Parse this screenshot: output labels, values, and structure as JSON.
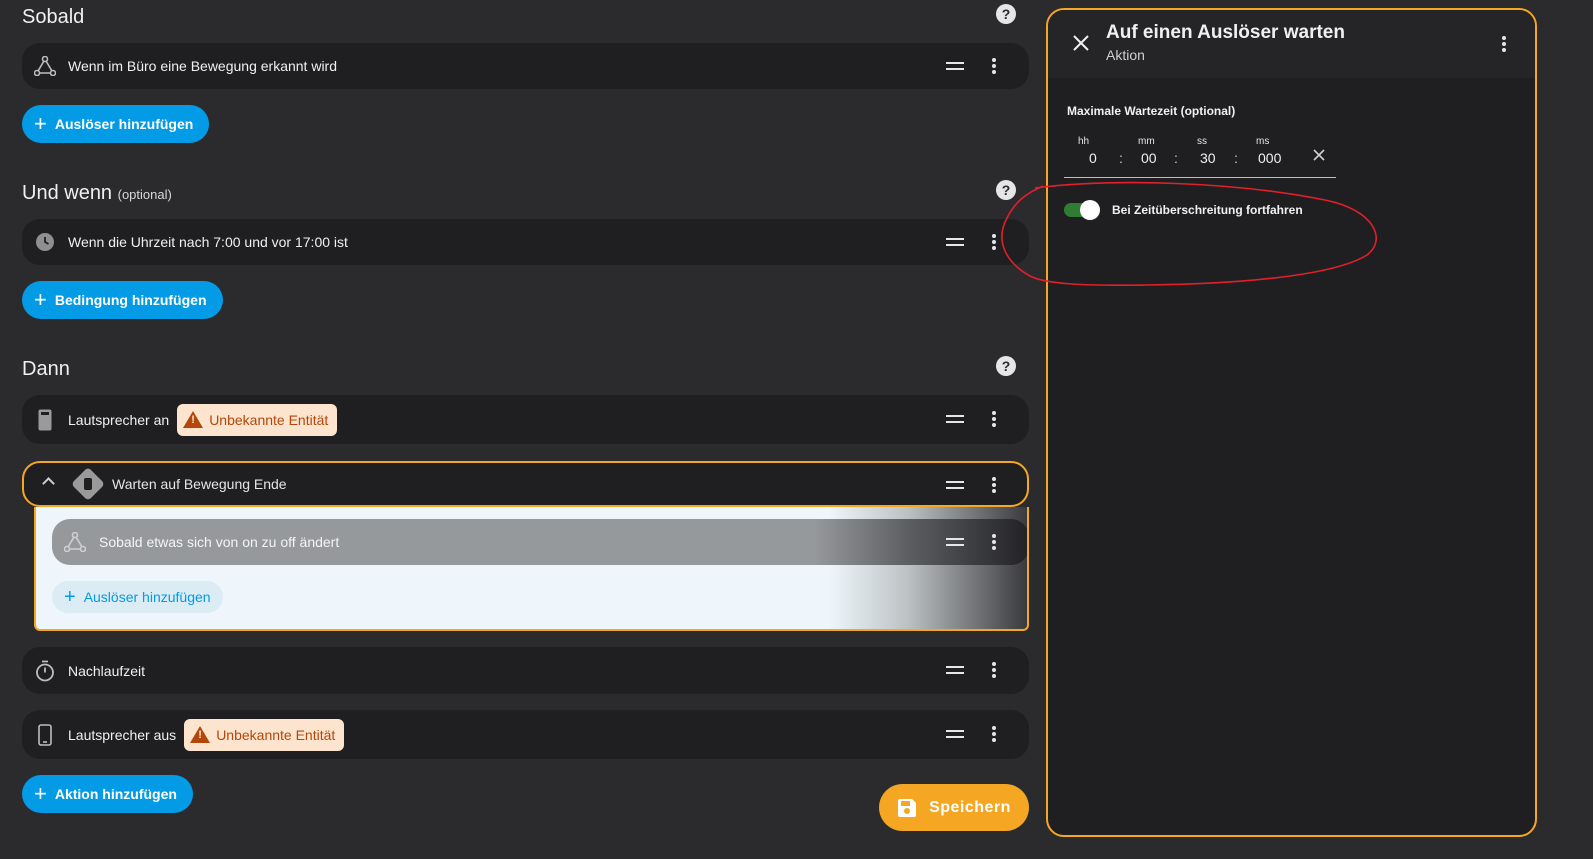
{
  "left": {
    "sobald": {
      "title": "Sobald",
      "trigger": "Wenn im Büro eine Bewegung erkannt wird",
      "add_button": "Auslöser hinzufügen"
    },
    "und_wenn": {
      "title": "Und wenn",
      "optional": "(optional)",
      "condition": "Wenn die Uhrzeit nach 7:00 und vor 17:00 ist",
      "add_button": "Bedingung hinzufügen"
    },
    "dann": {
      "title": "Dann",
      "action1_label": "Lautsprecher an",
      "action1_badge": "Unbekannte Entität",
      "wait_label": "Warten auf Bewegung Ende",
      "nested_trigger": "Sobald etwas sich von on zu off ändert",
      "nested_add": "Auslöser hinzufügen",
      "action3_label": "Nachlaufzeit",
      "action4_label": "Lautsprecher aus",
      "action4_badge": "Unbekannte Entität",
      "add_button": "Aktion hinzufügen"
    },
    "save_button": "Speichern"
  },
  "panel": {
    "title": "Auf einen Auslöser warten",
    "subtitle": "Aktion",
    "timeout_label": "Maximale Wartezeit (optional)",
    "time_fields": [
      {
        "unit": "hh",
        "value": "0"
      },
      {
        "unit": "mm",
        "value": "00"
      },
      {
        "unit": "ss",
        "value": "30"
      },
      {
        "unit": "ms",
        "value": "000"
      }
    ],
    "separator": ":",
    "toggle_label": "Bei Zeitüberschreitung fortfahren",
    "toggle_on": true
  },
  "colors": {
    "accent_blue": "#039be5",
    "accent_orange": "#f5a623",
    "toggle_green": "#2e7d32",
    "annotation_red": "#e0202a"
  }
}
